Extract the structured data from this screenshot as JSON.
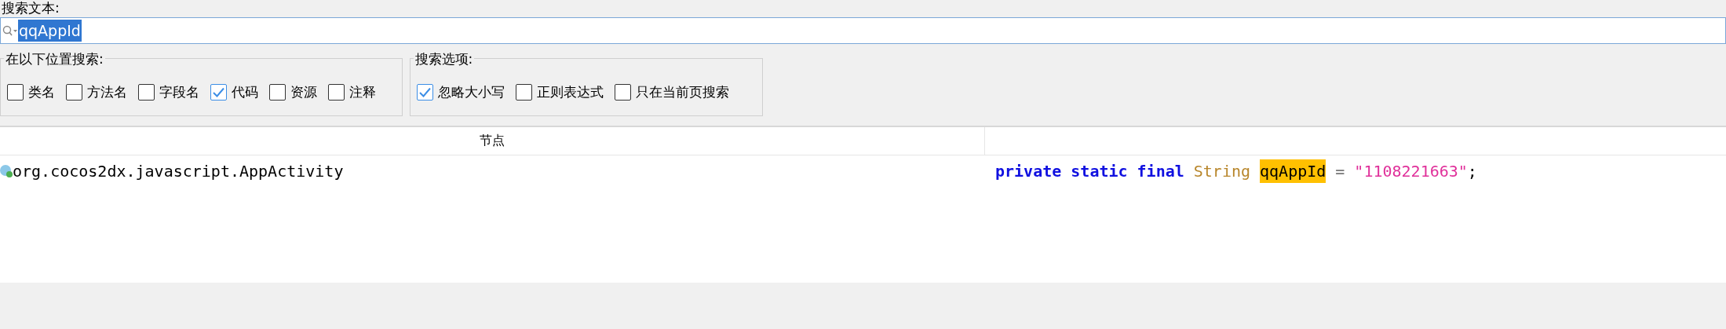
{
  "search_label": "搜索文本:",
  "search": {
    "value": "qqAppId",
    "selected": true
  },
  "location_group": {
    "title": "在以下位置搜索:",
    "options": [
      {
        "label": "类名",
        "checked": false
      },
      {
        "label": "方法名",
        "checked": false
      },
      {
        "label": "字段名",
        "checked": false
      },
      {
        "label": "代码",
        "checked": true
      },
      {
        "label": "资源",
        "checked": false
      },
      {
        "label": "注释",
        "checked": false
      }
    ]
  },
  "options_group": {
    "title": "搜索选项:",
    "options": [
      {
        "label": "忽略大小写",
        "checked": true
      },
      {
        "label": "正则表达式",
        "checked": false
      },
      {
        "label": "只在当前页搜索",
        "checked": false
      }
    ]
  },
  "table": {
    "columns": [
      "节点"
    ],
    "rows": [
      {
        "node": "org.cocos2dx.javascript.AppActivity",
        "code": [
          {
            "kind": "keyword",
            "text": "private"
          },
          {
            "kind": "keyword",
            "text": "static"
          },
          {
            "kind": "keyword",
            "text": "final"
          },
          {
            "kind": "type",
            "text": "String"
          },
          {
            "kind": "match",
            "text": "qqAppId"
          },
          {
            "kind": "plain",
            "text": "="
          },
          {
            "kind": "string",
            "text": "\"1108221663\""
          },
          {
            "kind": "punct",
            "text": ";"
          }
        ]
      }
    ]
  }
}
